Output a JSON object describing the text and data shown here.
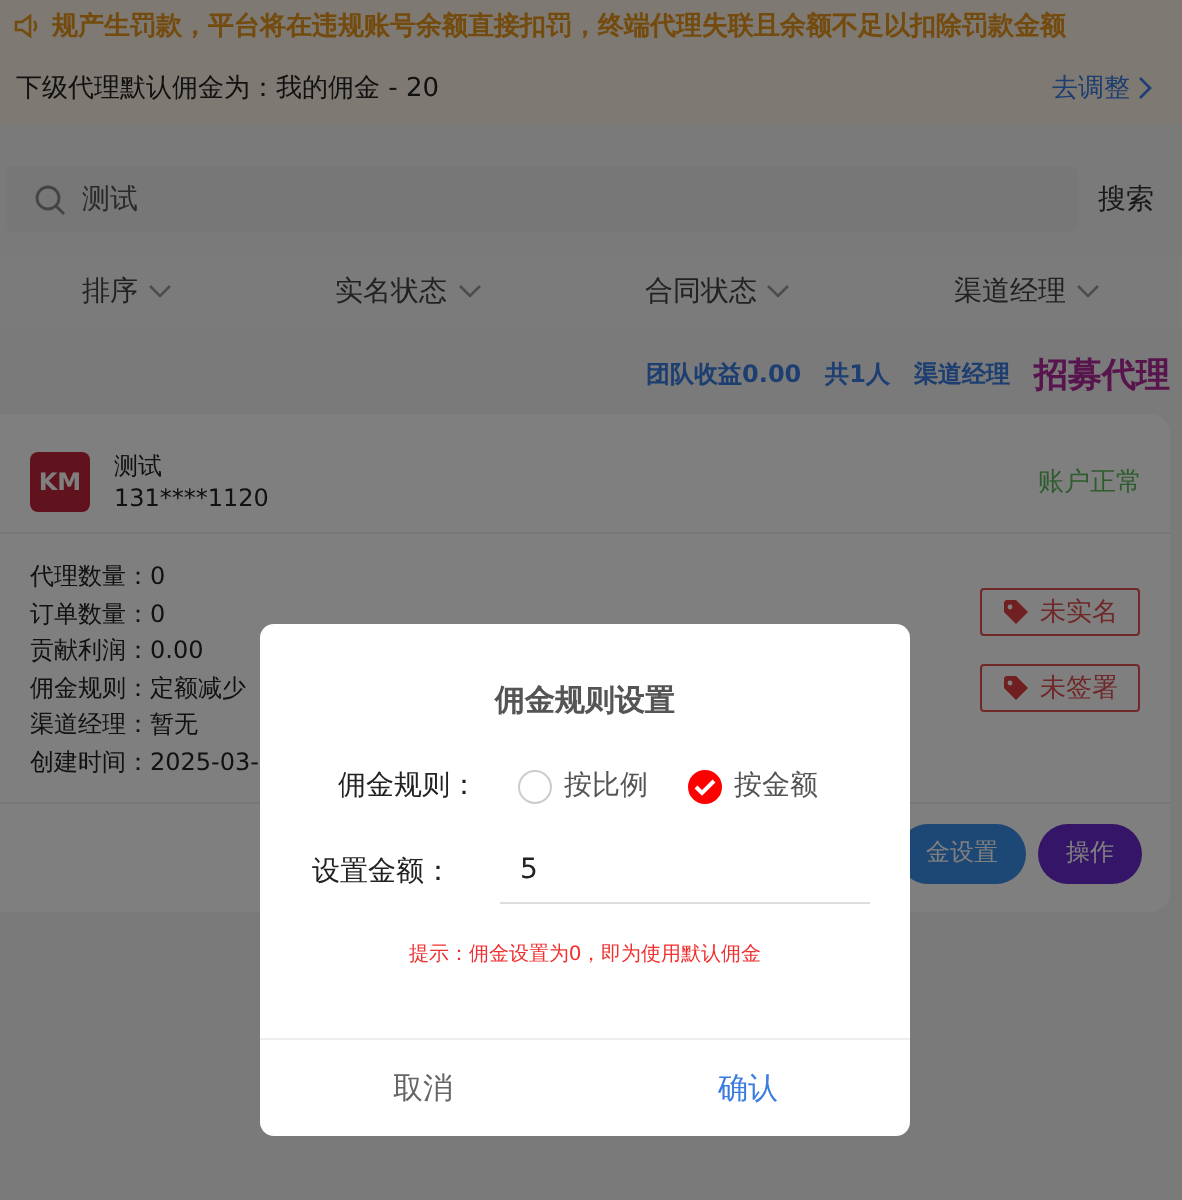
{
  "notice": {
    "text": "规产生罚款，平台将在违规账号余额直接扣罚，终端代理失联且余额不足以扣除罚款金额"
  },
  "default_commission": {
    "text": "下级代理默认佣金为：我的佣金 - 20",
    "link": "去调整"
  },
  "search": {
    "value": "测试",
    "button": "搜索"
  },
  "filters": [
    "排序",
    "实名状态",
    "合同状态",
    "渠道经理"
  ],
  "stats": {
    "items": [
      "团队收益0.00",
      "共1人",
      "渠道经理"
    ],
    "recruit": "招募代理"
  },
  "card": {
    "logo": "KM",
    "name": "测试",
    "phone": "131****1120",
    "status": "账户正常",
    "details": [
      "代理数量：0",
      "订单数量：0",
      "贡献利润：0.00",
      "佣金规则：定额减少",
      "渠道经理：暂无",
      "创建时间：2025-03-"
    ],
    "tags": [
      "未实名",
      "未签署"
    ],
    "buttons": [
      {
        "label": "金设置",
        "kind": "secondary"
      },
      {
        "label": "操作",
        "kind": "primary"
      }
    ]
  },
  "dialog": {
    "title": "佣金规则设置",
    "rule_label": "佣金规则：",
    "rule_options": [
      {
        "label": "按比例",
        "selected": false
      },
      {
        "label": "按金额",
        "selected": true
      }
    ],
    "amount_label": "设置金额：",
    "amount_value": "5",
    "hint": "提示：佣金设置为0，即为使用默认佣金",
    "cancel": "取消",
    "confirm": "确认"
  }
}
